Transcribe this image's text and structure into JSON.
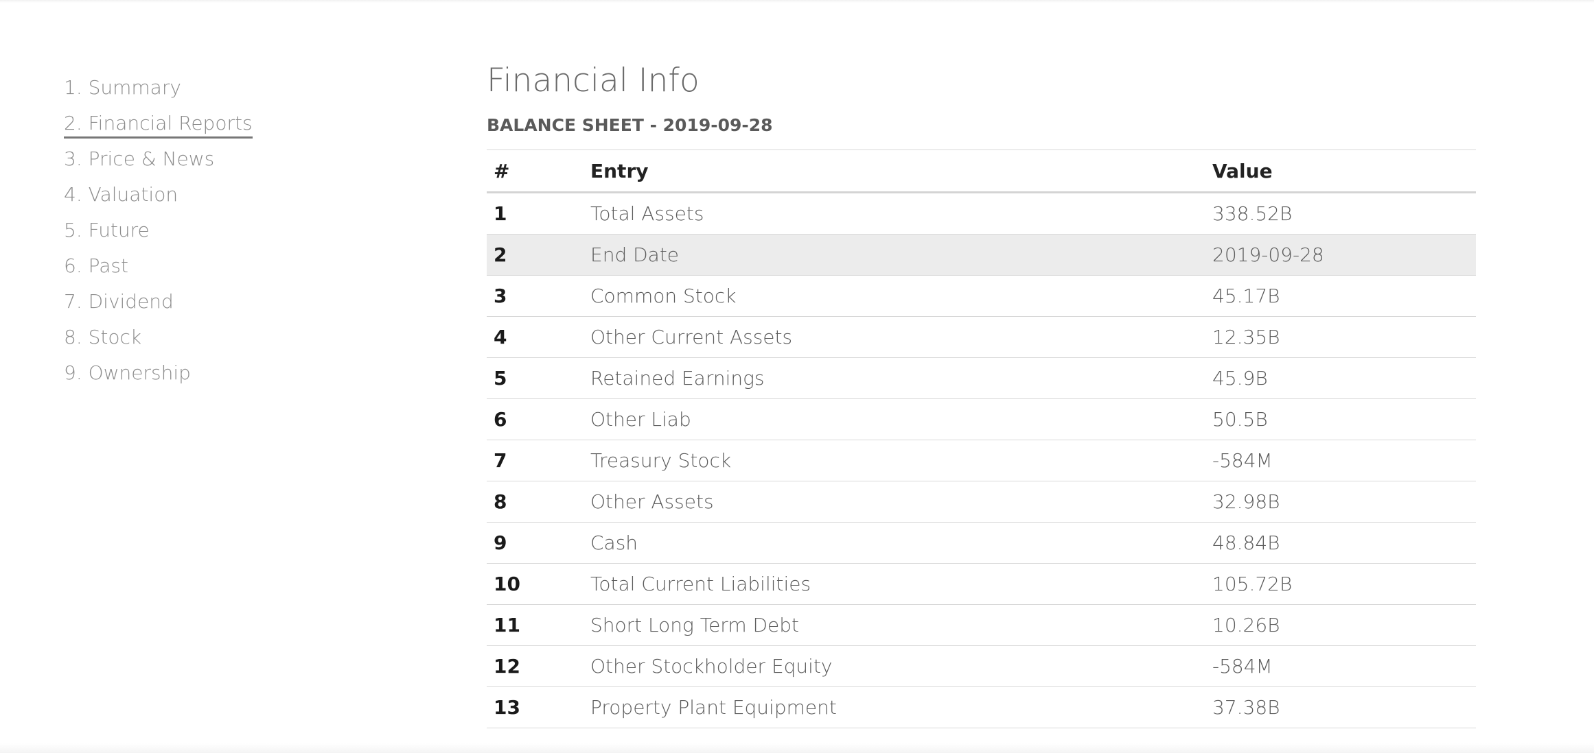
{
  "sidebar": {
    "items": [
      {
        "label": "1. Summary"
      },
      {
        "label": "2. Financial Reports"
      },
      {
        "label": "3. Price & News"
      },
      {
        "label": "4. Valuation"
      },
      {
        "label": "5. Future"
      },
      {
        "label": "6. Past"
      },
      {
        "label": "7. Dividend"
      },
      {
        "label": "8. Stock"
      },
      {
        "label": "9. Ownership"
      }
    ],
    "active_index": 1
  },
  "main": {
    "title": "Financial Info",
    "section_title": "BALANCE SHEET - 2019-09-28",
    "table": {
      "headers": {
        "num": "#",
        "entry": "Entry",
        "value": "Value"
      },
      "rows": [
        {
          "num": "1",
          "entry": "Total Assets",
          "value": "338.52B"
        },
        {
          "num": "2",
          "entry": "End Date",
          "value": "2019-09-28"
        },
        {
          "num": "3",
          "entry": "Common Stock",
          "value": "45.17B"
        },
        {
          "num": "4",
          "entry": "Other Current Assets",
          "value": "12.35B"
        },
        {
          "num": "5",
          "entry": "Retained Earnings",
          "value": "45.9B"
        },
        {
          "num": "6",
          "entry": "Other Liab",
          "value": "50.5B"
        },
        {
          "num": "7",
          "entry": "Treasury Stock",
          "value": "-584M"
        },
        {
          "num": "8",
          "entry": "Other Assets",
          "value": "32.98B"
        },
        {
          "num": "9",
          "entry": "Cash",
          "value": "48.84B"
        },
        {
          "num": "10",
          "entry": "Total Current Liabilities",
          "value": "105.72B"
        },
        {
          "num": "11",
          "entry": "Short Long Term Debt",
          "value": "10.26B"
        },
        {
          "num": "12",
          "entry": "Other Stockholder Equity",
          "value": "-584M"
        },
        {
          "num": "13",
          "entry": "Property Plant Equipment",
          "value": "37.38B"
        }
      ],
      "highlighted_row_index": 1
    }
  },
  "colors": {
    "nav_text": "#8c8c8c",
    "row_highlight": "#ececec",
    "divider": "#d8d8d8"
  }
}
